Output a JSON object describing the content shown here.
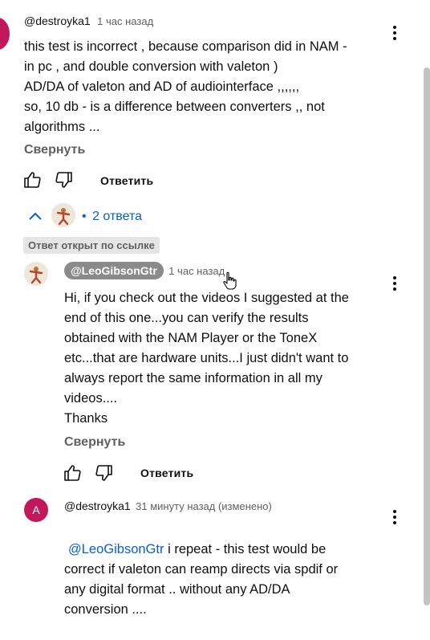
{
  "comment1": {
    "handle": "@destroyka1",
    "time": "1 час назад",
    "body": "this test is incorrect , because comparison did in  NAM -\nin pc ,  and double conversion with valeton )\nAD/DA of valeton and AD of audiointerface ,,,,,,\nso, 10 db - is a difference between converters ,, not\nalgorithms ...",
    "collapse_label": "Свернуть",
    "reply_label": "Ответить"
  },
  "replies_toggle": {
    "bullet": "•",
    "label": "2 ответа"
  },
  "linked_chip": "Ответ открыт по ссылке",
  "reply1": {
    "handle": "@LeoGibsonGtr",
    "time": "1 час назад",
    "body": "Hi, if you check out the videos I suggested at the\nend of this one...you can verify the results\nobtained with the NAM Player or the ToneX\netc...that are hardware units...I just didn't want to\nalways report the same information in all my\nvideos....\nThanks",
    "collapse_label": "Свернуть",
    "reply_label": "Ответить"
  },
  "reply2": {
    "avatar_letter": "A",
    "handle": "@destroyka1",
    "time": "31 минуту назад (изменено)",
    "mention": "@LeoGibsonGtr",
    "body_first": "  i repeat - this test would be",
    "body_rest": "correct if valeton can reamp directs via spdif or\nany digital format .. without any AD/DA\nconversion ....",
    "accent_color": "#c2185b"
  },
  "colors": {
    "link": "#065fd4",
    "secondary": "#606060",
    "avatar_pink": "#c2185b"
  }
}
